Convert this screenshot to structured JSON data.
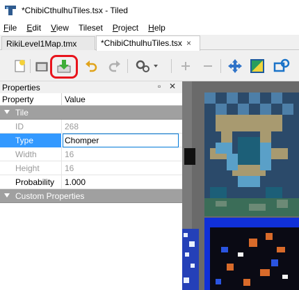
{
  "window": {
    "title": "*ChibiCthulhuTiles.tsx - Tiled"
  },
  "menu": [
    {
      "label": "File",
      "mnemonic": "F",
      "rest": "ile"
    },
    {
      "label": "Edit",
      "mnemonic": "E",
      "rest": "dit"
    },
    {
      "label": "View",
      "mnemonic": "V",
      "rest": "iew"
    },
    {
      "label": "Tileset",
      "mnemonic": "",
      "rest": "Tileset"
    },
    {
      "label": "Project",
      "mnemonic": "P",
      "rest": "roject"
    },
    {
      "label": "Help",
      "mnemonic": "H",
      "rest": "elp"
    }
  ],
  "tabs": [
    {
      "label": "RikiLevel1Map.tmx",
      "active": false
    },
    {
      "label": "*ChibiCthulhuTiles.tsx",
      "active": true,
      "close": "×"
    }
  ],
  "toolbar": {
    "icons": [
      "new-icon",
      "open-icon",
      "save-icon",
      "undo-icon",
      "redo-icon",
      "commands-icon",
      "add-tiles-icon",
      "remove-tiles-icon",
      "dynamic-wrapping-icon",
      "edit-terrain-icon",
      "edit-collision-icon"
    ],
    "highlight_color": "#e8141c"
  },
  "properties_panel": {
    "title": "Properties",
    "float_glyph": "▫",
    "close_glyph": "✕",
    "columns": {
      "property": "Property",
      "value": "Value"
    },
    "groups": {
      "tile": "Tile",
      "custom": "Custom Properties"
    },
    "rows": {
      "id": {
        "key": "ID",
        "value": "268"
      },
      "type": {
        "key": "Type",
        "value": "Chomper"
      },
      "width": {
        "key": "Width",
        "value": "16"
      },
      "height": {
        "key": "Height",
        "value": "16"
      },
      "probability": {
        "key": "Probability",
        "value": "1.000"
      }
    }
  },
  "colors": {
    "selection": "#3399ff",
    "group_header": "#a0a0a0",
    "canvas_bg": "#6a6a6a"
  }
}
